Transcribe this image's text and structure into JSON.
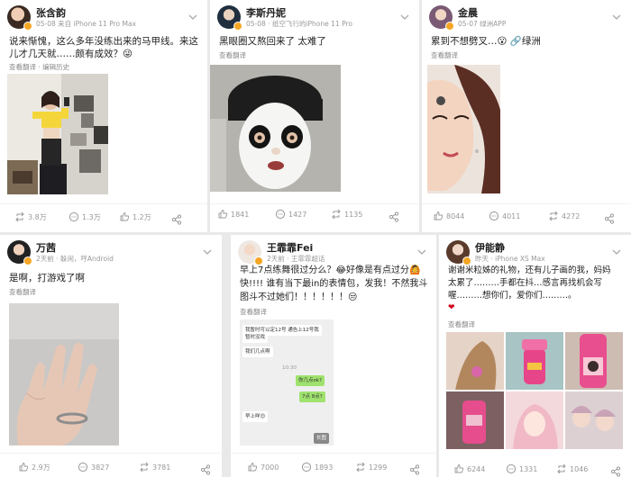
{
  "posts": [
    {
      "user": "张含韵",
      "meta": "05-08 来自 iPhone 11 Pro Max",
      "text_line1": "说来惭愧，这么多年没练出来的马甲线。来这",
      "text_line2": "儿才几天就……颇有成效？😜",
      "sub": "查看翻译 · 编辑历史",
      "reposts": "3.8万",
      "comments": "1.3万",
      "likes": "1.2万"
    },
    {
      "user": "李斯丹妮",
      "meta": "05-08 · 纸空飞行的iPhone 11 Pro",
      "text_line1": "黑眼圈又熬回来了 太难了",
      "sub": "查看翻译",
      "reposts": "1841",
      "comments": "1427",
      "likes": "1135"
    },
    {
      "user": "金晨",
      "meta": "05-07 绿洲APP",
      "text_line1": "累到不想劈叉…😮 🔗绿洲",
      "sub": "查看翻译",
      "reposts": "8044",
      "comments": "4011",
      "likes": "4272"
    },
    {
      "user": "万茜",
      "meta": "2天前 · 躲闲，哼Android",
      "text_line1": "是啊，打游戏了啊",
      "sub": "查看翻译",
      "reposts": "2.9万",
      "comments": "3827",
      "likes": "3781"
    },
    {
      "user": "王霏霏Fei",
      "meta": "2天前 · 王霏霏超话",
      "text_line1": "早上7点练舞很过分么？😂好像是有点过分🙆",
      "text_line2": "快!!!! 谁有当下最in的表情包，发我！不然我斗",
      "text_line3": "图斗不过她们！！！！！！😒",
      "sub": "查看翻译",
      "chat": [
        "我暂时可以定12号 通告上12号我",
        "暂时没戏",
        "我们几点啊",
        "10:30",
        "你几点ok?",
        "7点 8点?",
        "早上咩😊",
        "长图"
      ],
      "reposts": "7000",
      "comments": "1893",
      "likes": "1299"
    },
    {
      "user": "伊能静",
      "meta": "昨天 · iPhone XS Max",
      "text_line1": "谢谢米粒姊的礼物，还有儿子画的我，妈妈",
      "text_line2": "太累了………手都在抖…感言再找机会写",
      "text_line3": "喔………想你们，爱你们………。",
      "heart": "❤",
      "sub": "查看翻译",
      "reposts": "6244",
      "comments": "1331",
      "likes": "1046"
    }
  ],
  "colors": {
    "accent": "#f5a623",
    "link": "#2a7ad5",
    "meta_gray": "#999999",
    "panel_bg": "#e9e9e9"
  },
  "icons": {
    "repost": "repost-icon",
    "comment": "comment-icon",
    "like": "like-icon",
    "share": "share-icon",
    "chevron": "chevron-down-icon"
  }
}
